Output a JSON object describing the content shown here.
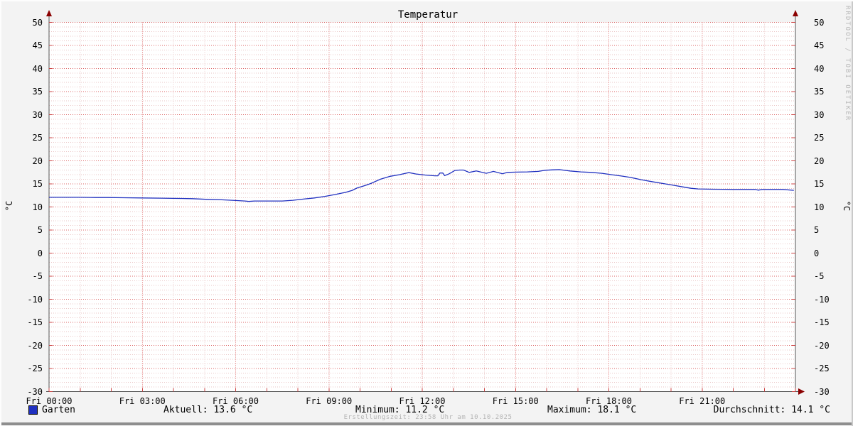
{
  "title": "Temperatur",
  "watermark": "RRDTOOL / TOBI OETIKER",
  "footer_note": "Erstellungszeit: 23:58 Uhr am 10.10.2025",
  "legend": {
    "series_label": "Garten"
  },
  "stats_text": {
    "aktuell": "Aktuell: 13.6 °C",
    "minimum": "Minimum: 11.2 °C",
    "maximum": "Maximum: 18.1 °C",
    "durchschnitt": "Durchschnitt: 14.1 °C"
  },
  "axis_units": {
    "left": "°C",
    "right": "°C"
  },
  "colors": {
    "background": "#f3f3f3",
    "canvas": "#ffffff",
    "grid_major": "#dd6666",
    "grid_minor": "#eac6c6",
    "axis": "#555555",
    "arrow": "#8b0000",
    "tick": "#cc4444",
    "series": "#2030c0",
    "text": "#000000",
    "muted": "#b4b4b4"
  },
  "chart_data": {
    "type": "line",
    "title": "Temperatur",
    "xlabel": "",
    "ylabel_left": "°C",
    "ylabel_right": "°C",
    "ylim": [
      -30,
      50
    ],
    "y_major_step": 5,
    "y_minor_step": 1,
    "xlim_hours": [
      0,
      24
    ],
    "x_major_step_hours": 3,
    "x_minor_step_hours": 1,
    "x_tick_labels": [
      "Fri 00:00",
      "Fri 03:00",
      "Fri 06:00",
      "Fri 09:00",
      "Fri 12:00",
      "Fri 15:00",
      "Fri 18:00",
      "Fri 21:00"
    ],
    "grid": true,
    "legend_position": "bottom",
    "stats": {
      "aktuell": 13.6,
      "minimum": 11.2,
      "maximum": 18.1,
      "durchschnitt": 14.1
    },
    "series": [
      {
        "name": "Garten",
        "color": "#2030c0",
        "points_hour_degc": [
          [
            0,
            12.1
          ],
          [
            0.5,
            12.1
          ],
          [
            1,
            12.1
          ],
          [
            1.5,
            12.05
          ],
          [
            1.9,
            12.05
          ],
          [
            2.4,
            12.0
          ],
          [
            3.0,
            11.95
          ],
          [
            3.6,
            11.9
          ],
          [
            4.2,
            11.85
          ],
          [
            4.6,
            11.8
          ],
          [
            5.1,
            11.65
          ],
          [
            5.55,
            11.55
          ],
          [
            6.0,
            11.4
          ],
          [
            6.3,
            11.3
          ],
          [
            6.42,
            11.2
          ],
          [
            6.6,
            11.3
          ],
          [
            7.0,
            11.3
          ],
          [
            7.5,
            11.3
          ],
          [
            7.84,
            11.45
          ],
          [
            8.18,
            11.7
          ],
          [
            8.53,
            11.95
          ],
          [
            8.87,
            12.3
          ],
          [
            9.21,
            12.7
          ],
          [
            9.55,
            13.2
          ],
          [
            9.75,
            13.6
          ],
          [
            9.9,
            14.1
          ],
          [
            10.19,
            14.7
          ],
          [
            10.35,
            15.1
          ],
          [
            10.65,
            16.0
          ],
          [
            10.97,
            16.65
          ],
          [
            11.27,
            17.0
          ],
          [
            11.57,
            17.45
          ],
          [
            11.79,
            17.15
          ],
          [
            12.11,
            16.9
          ],
          [
            12.41,
            16.75
          ],
          [
            12.5,
            16.75
          ],
          [
            12.57,
            17.35
          ],
          [
            12.66,
            17.35
          ],
          [
            12.72,
            16.8
          ],
          [
            12.87,
            17.2
          ],
          [
            13.05,
            17.9
          ],
          [
            13.2,
            18.0
          ],
          [
            13.33,
            18.0
          ],
          [
            13.51,
            17.5
          ],
          [
            13.74,
            17.8
          ],
          [
            14.06,
            17.3
          ],
          [
            14.29,
            17.7
          ],
          [
            14.58,
            17.2
          ],
          [
            14.74,
            17.5
          ],
          [
            15.04,
            17.55
          ],
          [
            15.38,
            17.6
          ],
          [
            15.73,
            17.7
          ],
          [
            15.95,
            17.95
          ],
          [
            16.2,
            18.05
          ],
          [
            16.41,
            18.1
          ],
          [
            16.75,
            17.8
          ],
          [
            17.1,
            17.6
          ],
          [
            17.44,
            17.5
          ],
          [
            17.78,
            17.3
          ],
          [
            18.08,
            17.0
          ],
          [
            18.4,
            16.7
          ],
          [
            18.7,
            16.4
          ],
          [
            19.04,
            15.9
          ],
          [
            19.38,
            15.5
          ],
          [
            19.73,
            15.1
          ],
          [
            20.07,
            14.7
          ],
          [
            20.37,
            14.35
          ],
          [
            20.64,
            14.05
          ],
          [
            20.87,
            13.9
          ],
          [
            21.33,
            13.85
          ],
          [
            22.0,
            13.8
          ],
          [
            22.7,
            13.8
          ],
          [
            22.81,
            13.65
          ],
          [
            22.93,
            13.8
          ],
          [
            23.6,
            13.8
          ],
          [
            23.95,
            13.6
          ]
        ]
      }
    ]
  }
}
